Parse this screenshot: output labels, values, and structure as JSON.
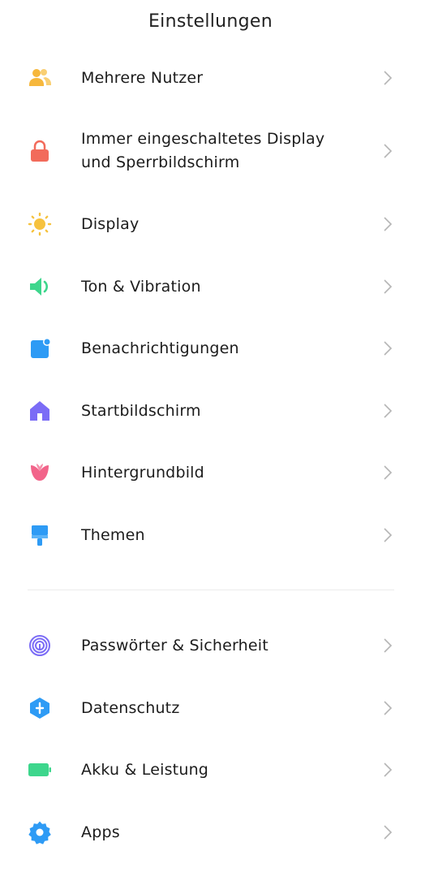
{
  "header": {
    "title": "Einstellungen"
  },
  "group1": [
    {
      "label": "Mehrere Nutzer",
      "icon": "users-icon",
      "color": "#F6B73C"
    },
    {
      "label": "Immer eingeschaltetes Display\nund Sperrbildschirm",
      "icon": "lock-icon",
      "color": "#F26B5B"
    },
    {
      "label": "Display",
      "icon": "sun-icon",
      "color": "#F6C23E"
    },
    {
      "label": "Ton & Vibration",
      "icon": "speaker-icon",
      "color": "#3DD68C"
    },
    {
      "label": "Benachrichtigungen",
      "icon": "notification-icon",
      "color": "#2E9BF5"
    },
    {
      "label": "Startbildschirm",
      "icon": "home-icon",
      "color": "#7B6CF6"
    },
    {
      "label": "Hintergrundbild",
      "icon": "tulip-icon",
      "color": "#F2648A"
    },
    {
      "label": "Themen",
      "icon": "paintbrush-icon",
      "color": "#2E9BF5"
    }
  ],
  "group2": [
    {
      "label": "Passwörter & Sicherheit",
      "icon": "fingerprint-icon",
      "color": "#7B6CF6"
    },
    {
      "label": "Datenschutz",
      "icon": "shield-icon",
      "color": "#2E9BF5"
    },
    {
      "label": "Akku & Leistung",
      "icon": "battery-icon",
      "color": "#3DD68C"
    },
    {
      "label": "Apps",
      "icon": "gear-icon",
      "color": "#2E9BF5"
    }
  ]
}
